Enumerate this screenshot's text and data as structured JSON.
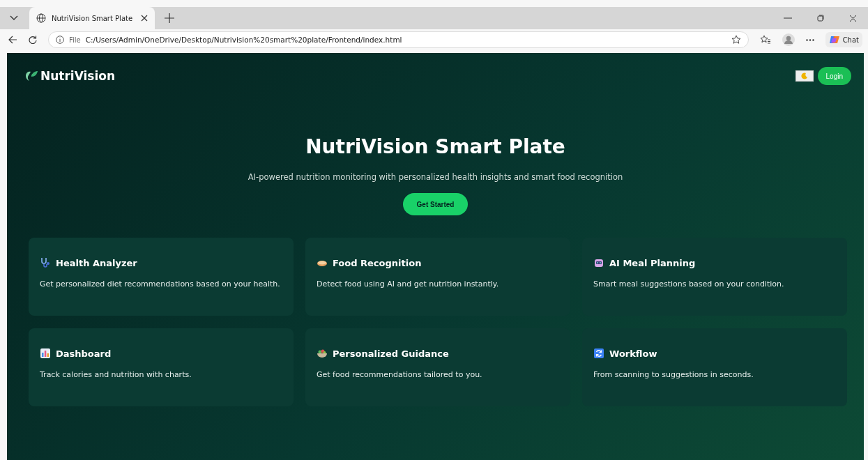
{
  "browser": {
    "tab": {
      "title": "NutriVision Smart Plate"
    },
    "address": {
      "scheme": "File",
      "url": "C:/Users/Admin/OneDrive/Desktop/Nutrivision%20smart%20plate/Frontend/index.html"
    },
    "chat_label": "Chat"
  },
  "header": {
    "logo": "NutriVision",
    "login": "Login"
  },
  "hero": {
    "title": "NutriVision Smart Plate",
    "subtitle": "AI-powered nutrition monitoring with personalized health insights and smart food recognition",
    "cta": "Get Started"
  },
  "features": [
    {
      "title": "Health Analyzer",
      "text": "Get personalized diet recommendations based on your health."
    },
    {
      "title": "Food Recognition",
      "text": "Detect food using AI and get nutrition instantly."
    },
    {
      "title": "AI Meal Planning",
      "text": "Smart meal suggestions based on your condition."
    },
    {
      "title": "Dashboard",
      "text": "Track calories and nutrition with charts."
    },
    {
      "title": "Personalized Guidance",
      "text": "Get food recommendations tailored to you."
    },
    {
      "title": "Workflow",
      "text": "From scanning to suggestions in seconds."
    }
  ]
}
